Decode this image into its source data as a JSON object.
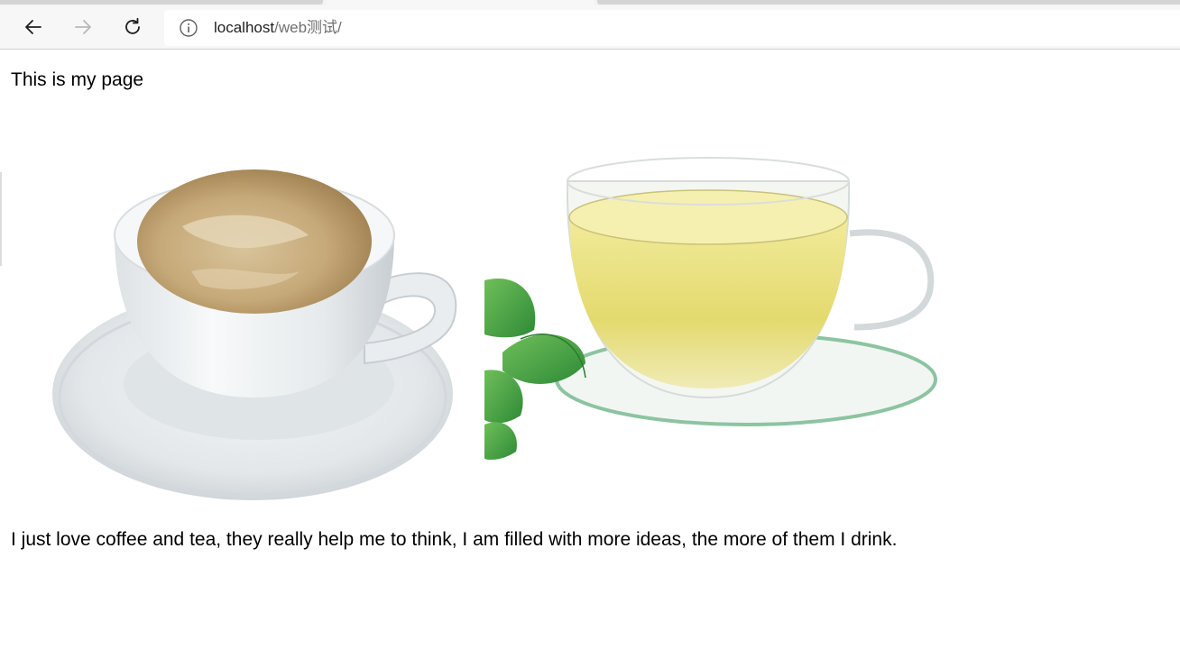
{
  "browser": {
    "address_host": "localhost",
    "address_path": "/web测试/",
    "icons": {
      "back": "arrow-left-icon",
      "forward": "arrow-right-icon",
      "reload": "reload-icon",
      "site_info": "info-icon"
    },
    "forward_enabled": false
  },
  "page": {
    "title": "This is my page",
    "images": [
      {
        "depicts": "coffee-cup"
      },
      {
        "depicts": "tea-cup"
      }
    ],
    "paragraph": "I just love coffee and tea, they really help me to think, I am filled with more ideas, the more of them I drink."
  }
}
